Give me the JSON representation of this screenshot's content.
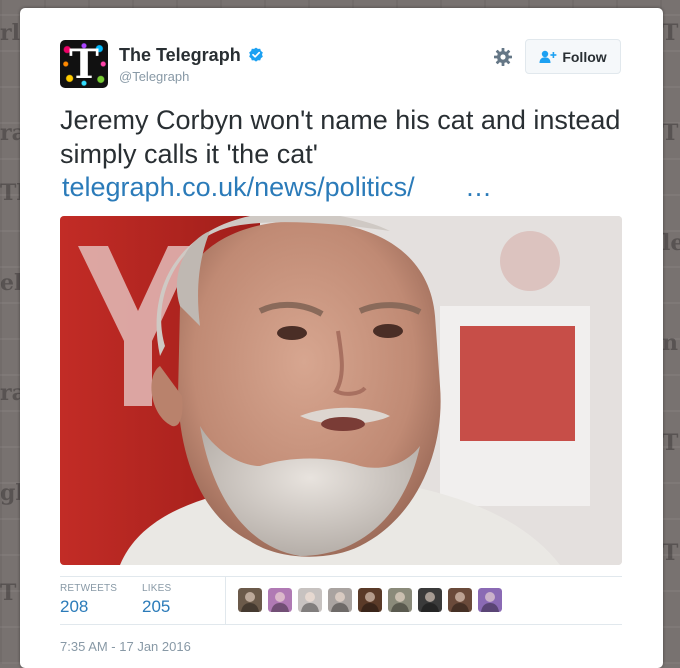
{
  "tweet": {
    "author_name": "The Telegraph",
    "author_handle": "@Telegraph",
    "avatar_letter": "T",
    "verified_icon": "verified-badge-icon",
    "text": "Jeremy Corbyn won't name his cat and instead simply calls it 'the cat'",
    "link_text": "telegraph.co.uk/news/politics/",
    "link_ellipsis": "…",
    "follow_label": "Follow",
    "stats": {
      "retweets_label": "RETWEETS",
      "retweets_count": "208",
      "likes_label": "LIKES",
      "likes_count": "205"
    },
    "liker_avatars": [
      {
        "icon": "liker-avatar-icon",
        "color": "#6b5a4a"
      },
      {
        "icon": "liker-avatar-icon",
        "color": "#b07ab4"
      },
      {
        "icon": "liker-avatar-icon",
        "color": "#c7c2c0"
      },
      {
        "icon": "liker-avatar-icon",
        "color": "#a9a3a0"
      },
      {
        "icon": "liker-avatar-icon",
        "color": "#5a3a28"
      },
      {
        "icon": "liker-avatar-icon",
        "color": "#8a8a7a"
      },
      {
        "icon": "liker-avatar-icon",
        "color": "#3a3a3a"
      },
      {
        "icon": "liker-avatar-icon",
        "color": "#6a4a3a"
      },
      {
        "icon": "liker-avatar-icon",
        "color": "#8a6ab4"
      }
    ],
    "timestamp": "7:35 AM - 17 Jan 2016"
  },
  "colors": {
    "link": "#2b7bb9",
    "text": "#292f33",
    "muted": "#8899a6",
    "verified": "#1da1f2",
    "photo_backdrop_red": "#b3241f"
  },
  "icons": {
    "gear": "gear-icon",
    "follow": "add-user-icon"
  }
}
